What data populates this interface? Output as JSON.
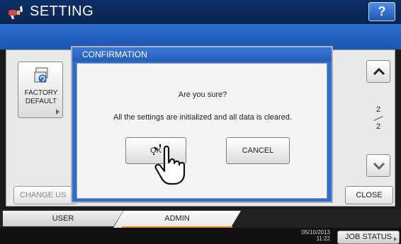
{
  "titlebar": {
    "title": "SETTING",
    "help_label": "?"
  },
  "panel": {
    "factory_label_line1": "FACTORY",
    "factory_label_line2": "DEFAULT",
    "page_current": "2",
    "page_total": "2",
    "change_user_label": "CHANGE US",
    "close_label": "CLOSE"
  },
  "dialog": {
    "title": "CONFIRMATION",
    "question": "Are you sure?",
    "message": "All the settings are initialized and all data is cleared.",
    "ok_label": "OK",
    "cancel_label": "CANCEL"
  },
  "tabs": [
    {
      "label": "USER",
      "active": false
    },
    {
      "label": "ADMIN",
      "active": true
    }
  ],
  "status": {
    "date": "05/10/2013",
    "time": "11:22",
    "job_status_label": "JOB STATUS"
  },
  "colors": {
    "accent": "#f08a1a",
    "titlebar": "#0d2e66",
    "bluebar": "#2d6fd0"
  }
}
